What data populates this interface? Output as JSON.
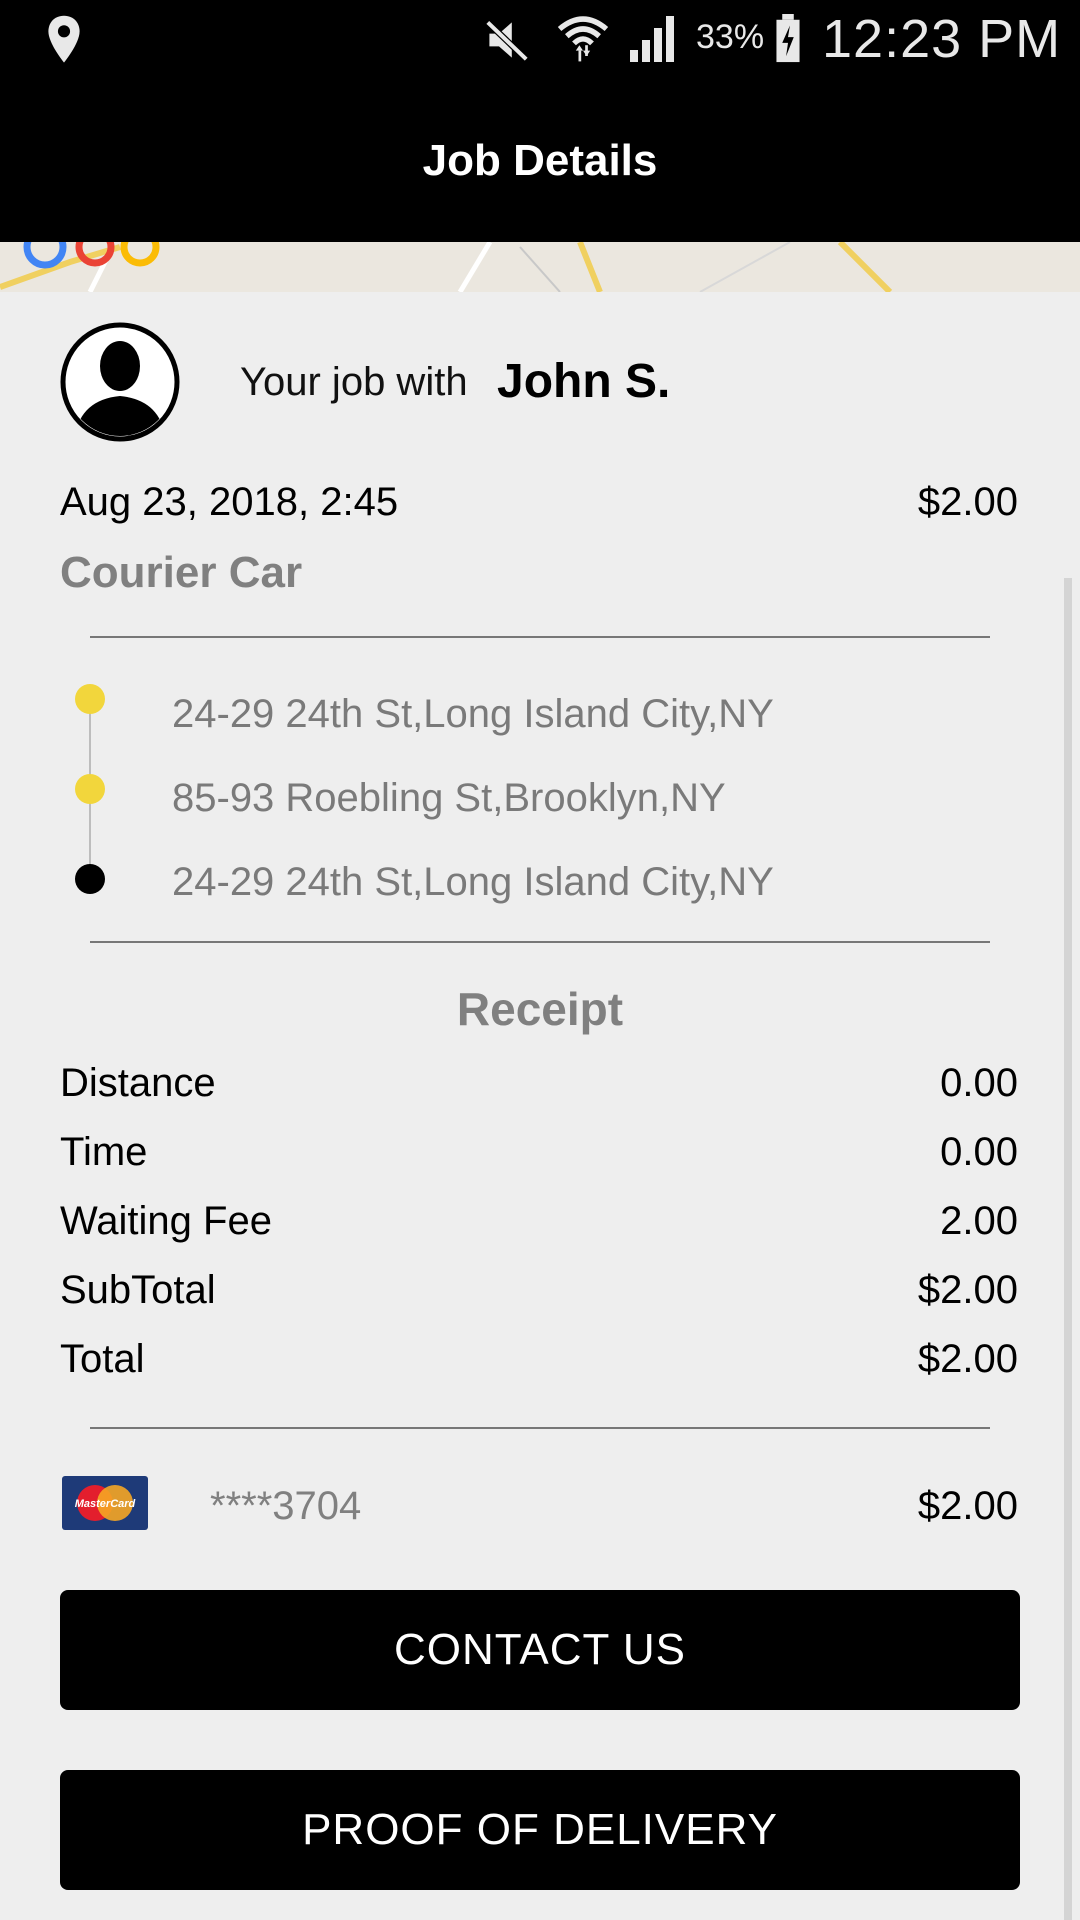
{
  "status_bar": {
    "battery_percent": "33%",
    "time": "12:23 PM",
    "icons": [
      "location-icon",
      "mute-icon",
      "wifi-icon",
      "signal-icon",
      "battery-charging-icon"
    ]
  },
  "header": {
    "title": "Job Details"
  },
  "job": {
    "with_label": "Your job with",
    "driver_name": "John S.",
    "date": "Aug 23, 2018, 2:45",
    "price": "$2.00",
    "service": "Courier Car"
  },
  "route": {
    "stops": [
      {
        "address": "24-29 24th St,Long Island City,NY",
        "dot_color": "#f2d63c"
      },
      {
        "address": "85-93 Roebling St,Brooklyn,NY",
        "dot_color": "#f2d63c"
      },
      {
        "address": "24-29 24th St,Long Island City,NY",
        "dot_color": "#000000"
      }
    ]
  },
  "receipt": {
    "title": "Receipt",
    "rows": [
      {
        "label": "Distance",
        "value": "0.00"
      },
      {
        "label": "Time",
        "value": "0.00"
      },
      {
        "label": "Waiting Fee",
        "value": "2.00"
      },
      {
        "label": "SubTotal",
        "value": "$2.00"
      },
      {
        "label": "Total",
        "value": "$2.00"
      }
    ]
  },
  "payment": {
    "card_brand_icon": "mastercard-icon",
    "card_logo_text": "MasterCard",
    "card_number": "****3704",
    "amount": "$2.00"
  },
  "buttons": {
    "contact_us": "CONTACT US",
    "proof_of_delivery": "PROOF OF DELIVERY"
  }
}
